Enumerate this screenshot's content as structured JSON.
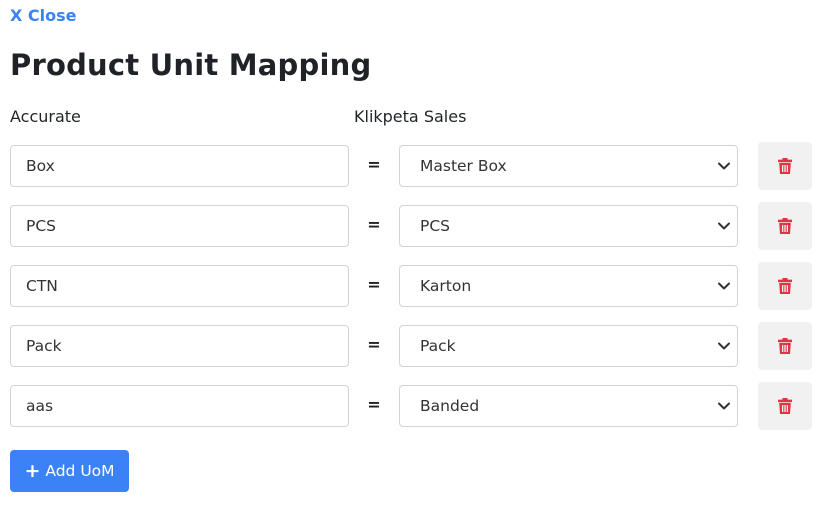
{
  "header": {
    "close_label": "X Close",
    "title": "Product Unit Mapping"
  },
  "columns": {
    "accurate": "Accurate",
    "klikpeta": "Klikpeta Sales"
  },
  "equals_symbol": "=",
  "mappings": [
    {
      "accurate": "Box",
      "klikpeta": "Master Box"
    },
    {
      "accurate": "PCS",
      "klikpeta": "PCS"
    },
    {
      "accurate": "CTN",
      "klikpeta": "Karton"
    },
    {
      "accurate": "Pack",
      "klikpeta": "Pack"
    },
    {
      "accurate": "aas",
      "klikpeta": "Banded"
    }
  ],
  "add_button": {
    "icon": "plus-icon",
    "label": "Add UoM"
  },
  "icons": {
    "delete": "trash-icon",
    "select": "chevron-down-icon"
  },
  "colors": {
    "accent": "#3b82f6",
    "danger": "#dc3545",
    "delete_bg": "#f1f1f1"
  }
}
